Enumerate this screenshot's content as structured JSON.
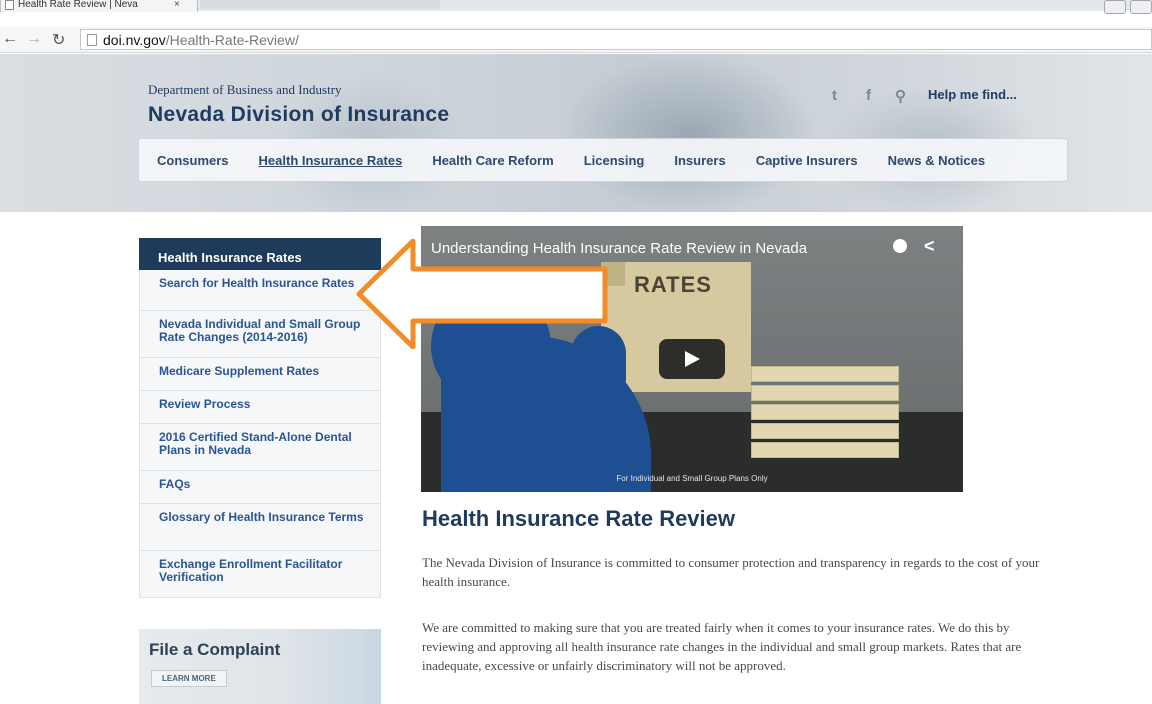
{
  "browser": {
    "tab_title": "Health Rate Review | Neva",
    "tab_close": "×",
    "url_host": "doi.nv.gov",
    "url_path": "/Health-Rate-Review/"
  },
  "header": {
    "department": "Department of Business and Industry",
    "agency": "Nevada Division of Insurance",
    "help_link": "Help me find..."
  },
  "main_nav": [
    {
      "label": "Consumers"
    },
    {
      "label": "Health Insurance Rates",
      "active": true
    },
    {
      "label": "Health Care Reform"
    },
    {
      "label": "Licensing"
    },
    {
      "label": "Insurers"
    },
    {
      "label": "Captive Insurers"
    },
    {
      "label": "News & Notices"
    }
  ],
  "sidebar": {
    "heading": "Health Insurance Rates",
    "items": [
      {
        "label": "Search for Health Insurance Rates"
      },
      {
        "label": "Nevada Individual and Small Group Rate Changes (2014-2016)"
      },
      {
        "label": "Medicare Supplement Rates"
      },
      {
        "label": "Review Process"
      },
      {
        "label": "2016 Certified Stand-Alone Dental Plans in Nevada"
      },
      {
        "label": "FAQs"
      },
      {
        "label": "Glossary of Health Insurance Terms"
      },
      {
        "label": "Exchange Enrollment Facilitator Verification"
      }
    ],
    "complaint_title": "File a Complaint",
    "complaint_button": "LEARN MORE"
  },
  "video": {
    "title": "Understanding Health Insurance Rate Review in Nevada",
    "rates_text": "RATES",
    "caption": "For Individual and Small Group Plans Only"
  },
  "content": {
    "title": "Health Insurance Rate Review",
    "para1": "The Nevada Division of Insurance is committed to consumer protection and transparency in regards to the cost of your health insurance.",
    "para2": "We are committed to making sure that you are treated fairly when it comes to your insurance rates. We do this by reviewing and approving all health insurance rate changes in the individual and small group markets. Rates that are inadequate, excessive or unfairly discriminatory will not be approved."
  },
  "colors": {
    "accent": "#1f3b5c",
    "link": "#2a5594",
    "annotation_arrow": "#f28c28"
  }
}
